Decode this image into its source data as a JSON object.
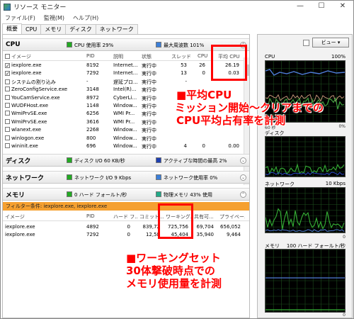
{
  "window": {
    "title": "リソース モニター",
    "min": "—",
    "max": "☐",
    "close": "✕"
  },
  "menu": [
    "ファイル(F)",
    "監視(M)",
    "ヘルプ(H)"
  ],
  "tabs": [
    "概要",
    "CPU",
    "メモリ",
    "ディスク",
    "ネットワーク"
  ],
  "cpu": {
    "title": "CPU",
    "summary1": "CPU 使用率 29%",
    "summary2": "最大周波数 101%",
    "headers": [
      "イメージ",
      "PID",
      "説明",
      "状態",
      "スレッド",
      "CPU",
      "平均 CPU"
    ],
    "rows": [
      {
        "name": "iexplore.exe",
        "pid": "8192",
        "desc": "Internet...",
        "state": "実行中",
        "threads": "53",
        "cpu": "26",
        "avg": "26.19",
        "checked": true
      },
      {
        "name": "iexplore.exe",
        "pid": "7292",
        "desc": "Internet...",
        "state": "実行中",
        "threads": "13",
        "cpu": "0",
        "avg": "0.03",
        "checked": true
      },
      {
        "name": "システムの割り込み",
        "pid": "-",
        "desc": "遅延プロ...",
        "state": "実行中",
        "threads": "-",
        "cpu": "",
        "avg": "",
        "checked": false
      },
      {
        "name": "ZeroConfigService.exe",
        "pid": "3148",
        "desc": "Intel(R)...",
        "state": "実行中",
        "threads": "",
        "cpu": "",
        "avg": "",
        "checked": false
      },
      {
        "name": "YouCamService.exe",
        "pid": "8972",
        "desc": "CyberLi...",
        "state": "実行中",
        "threads": "",
        "cpu": "",
        "avg": "",
        "checked": false
      },
      {
        "name": "WUDFHost.exe",
        "pid": "1148",
        "desc": "Window...",
        "state": "実行中",
        "threads": "",
        "cpu": "",
        "avg": "",
        "checked": false
      },
      {
        "name": "WmiPrvSE.exe",
        "pid": "6256",
        "desc": "WMI Pr...",
        "state": "実行中",
        "threads": "",
        "cpu": "",
        "avg": "",
        "checked": false
      },
      {
        "name": "WmiPrvSE.exe",
        "pid": "3616",
        "desc": "WMI Pr...",
        "state": "実行中",
        "threads": "",
        "cpu": "",
        "avg": "",
        "checked": false
      },
      {
        "name": "wlanext.exe",
        "pid": "2268",
        "desc": "Window...",
        "state": "実行中",
        "threads": "",
        "cpu": "",
        "avg": "",
        "checked": false
      },
      {
        "name": "winlogon.exe",
        "pid": "800",
        "desc": "Window...",
        "state": "実行中",
        "threads": "",
        "cpu": "",
        "avg": "",
        "checked": false
      },
      {
        "name": "wininit.exe",
        "pid": "696",
        "desc": "Window...",
        "state": "実行中",
        "threads": "4",
        "cpu": "0",
        "avg": "0.00",
        "checked": false
      }
    ]
  },
  "disk": {
    "title": "ディスク",
    "summary1": "ディスク I/O 60 KB/秒",
    "summary2": "アクティブな時間の最高 2%"
  },
  "network": {
    "title": "ネットワーク",
    "summary1": "ネットワーク I/O 9 Kbps",
    "summary2": "ネットワーク使用率 0%"
  },
  "memory": {
    "title": "メモリ",
    "summary1": "0 ハード フォールト/秒",
    "summary2": "物理メモリ 43% 使用",
    "filter": "フィルター条件: iexplore.exe, iexplore.exe",
    "headers": [
      "イメージ",
      "PID",
      "ハード フ...",
      "コミット...",
      "ワーキング...",
      "共有可...",
      "プライベー..."
    ],
    "rows": [
      {
        "name": "iexplore.exe",
        "pid": "4892",
        "hard": "0",
        "commit": "839,72",
        "working": "725,756",
        "share": "69,704",
        "private": "656,052"
      },
      {
        "name": "iexplore.exe",
        "pid": "7292",
        "hard": "0",
        "commit": "12,58",
        "working": "45,404",
        "share": "35,940",
        "private": "9,464"
      }
    ]
  },
  "side": {
    "view_label": "ビュー",
    "graphs": [
      {
        "name": "CPU",
        "max": "100%",
        "foot_left": "60 秒",
        "foot_right": "0%"
      },
      {
        "name": "ディスク",
        "max": "",
        "foot_left": "",
        "foot_right": ""
      },
      {
        "name": "ネットワーク",
        "max": "10 Kbps",
        "foot_left": "",
        "foot_right": "0"
      },
      {
        "name": "メモリ",
        "max": "100 ハード フォールト/秒",
        "foot_left": "",
        "foot_right": "0"
      }
    ]
  },
  "annotations": {
    "cpu_lines": [
      "■平均CPU",
      "ミッション開始～クリアまでの",
      "CPU平均占有率を計測"
    ],
    "mem_lines": [
      "■ワーキングセット",
      "30体撃破時点での",
      "メモリ使用量を計測"
    ]
  },
  "colors": {
    "cpu": "#22aa22",
    "freq": "#3b7fd8",
    "disk": "#22aa22",
    "disk_active": "#1e3fb0",
    "net": "#22aa22",
    "net_use": "#3b7fd8",
    "mem_fault": "#22aa22",
    "mem_phys": "#22aa88",
    "annotation": "#ff0000",
    "filter_bar": "#f5a030"
  }
}
